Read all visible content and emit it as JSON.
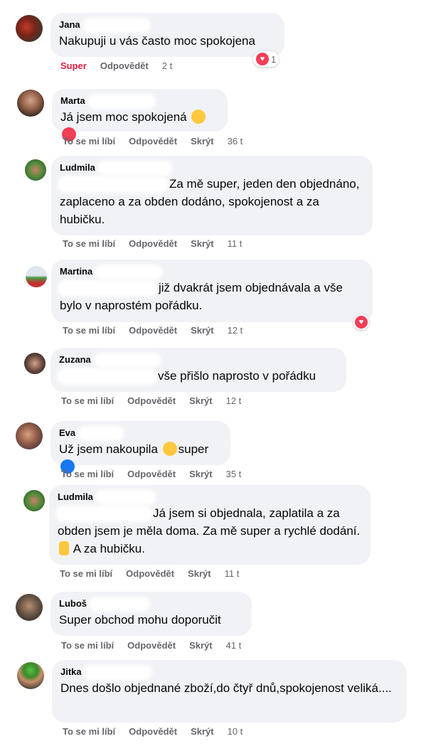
{
  "actions": {
    "like": "To se mi líbí",
    "reply": "Odpovědět",
    "hide": "Skrýt"
  },
  "icons": {
    "heart": "heart-reaction-icon",
    "like": "thumbs-up-icon",
    "wink": "wink-emoji",
    "laugh": "laugh-emoji",
    "hand": "hand-emoji"
  },
  "comments": [
    {
      "author": "Jana",
      "text": "Nakupuji u vás často moc spokojena",
      "reaction_label": "Super",
      "time": "2 t",
      "reaction_count": "1"
    },
    {
      "author": "Marta",
      "text": "Já jsem moc spokojená",
      "time": "36 t"
    },
    {
      "author": "Ludmila",
      "text": "Za mě super, jeden den objednáno, zaplaceno a za obden dodáno, spokojenost a za hubičku.",
      "time": "11 t"
    },
    {
      "author": "Martina",
      "text": "již dvakrát jsem objednávala a vše bylo v naprostém pořádku.",
      "time": "12 t"
    },
    {
      "author": "Zuzana",
      "text": "vše přišlo naprosto v pořádku",
      "time": "12 t"
    },
    {
      "author": "Eva",
      "text_before": "Už jsem nakoupila",
      "text_after": "super",
      "time": "35 t"
    },
    {
      "author": "Ludmila",
      "text_before": "Já jsem si objednala, zaplatila a za obden jsem je měla doma. Za mě super a rychlé dodání.",
      "text_after": "A za hubičku.",
      "time": "11 t"
    },
    {
      "author": "Luboš",
      "text": "Super obchod mohu doporučit",
      "time": "41 t"
    },
    {
      "author": "Jitka",
      "text": "Dnes došlo objednané zboží,do čtyř dnů,spokojenost veliká....",
      "time": "10 t"
    }
  ],
  "colors": {
    "bubble": "#f0f2f5",
    "meta": "#65676b",
    "super": "#e41e3f",
    "heart": "#f33e58",
    "like": "#1877f2"
  }
}
